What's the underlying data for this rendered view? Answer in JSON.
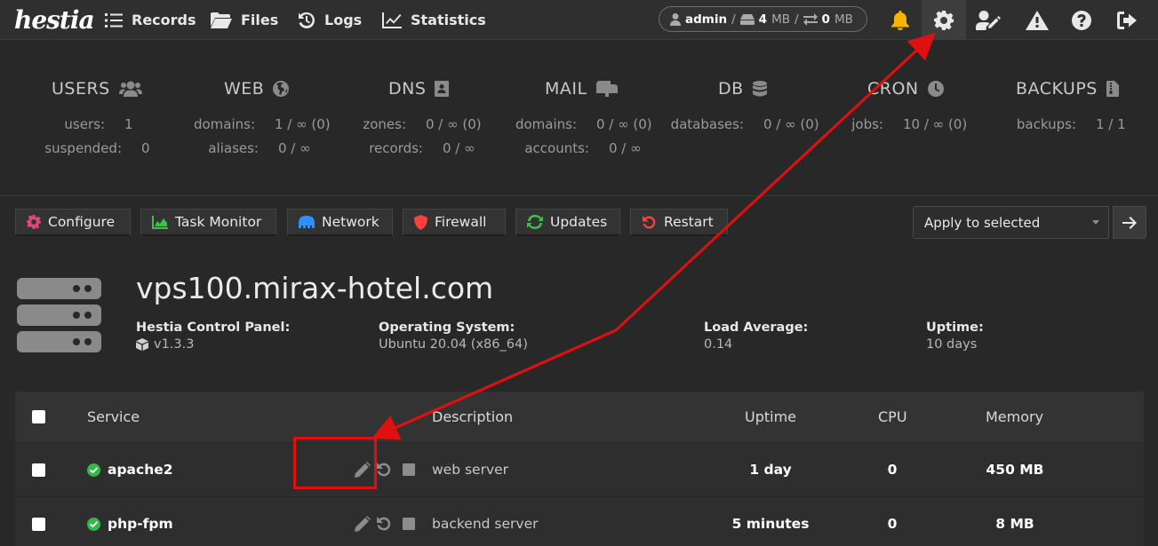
{
  "header": {
    "logo": "hestia",
    "nav": [
      {
        "label": "Records",
        "icon": "list-icon"
      },
      {
        "label": "Files",
        "icon": "folder-icon"
      },
      {
        "label": "Logs",
        "icon": "history-icon"
      },
      {
        "label": "Statistics",
        "icon": "chart-line-icon"
      }
    ],
    "user": {
      "name": "admin",
      "disk": "4",
      "disk_unit": "MB",
      "bandwidth": "0",
      "bandwidth_unit": "MB",
      "sep": "/"
    },
    "icons": [
      "bell-icon",
      "gear-icon",
      "user-edit-icon",
      "warning-icon",
      "help-icon",
      "logout-icon"
    ],
    "colors": {
      "bell": "#f7b500",
      "active_bg": "#3d3d3d"
    }
  },
  "stats": [
    {
      "title": "USERS",
      "icon": "users-icon",
      "rows": [
        {
          "k": "users:",
          "v": "1"
        },
        {
          "k": "suspended:",
          "v": "0"
        }
      ]
    },
    {
      "title": "WEB",
      "icon": "globe-icon",
      "rows": [
        {
          "k": "domains:",
          "v": "1 / ∞ (0)"
        },
        {
          "k": "aliases:",
          "v": "0 / ∞"
        }
      ]
    },
    {
      "title": "DNS",
      "icon": "address-book-icon",
      "rows": [
        {
          "k": "zones:",
          "v": "0 / ∞ (0)"
        },
        {
          "k": "records:",
          "v": "0 / ∞"
        }
      ]
    },
    {
      "title": "MAIL",
      "icon": "mailbox-icon",
      "rows": [
        {
          "k": "domains:",
          "v": "0 / ∞ (0)"
        },
        {
          "k": "accounts:",
          "v": "0 / ∞"
        }
      ]
    },
    {
      "title": "DB",
      "icon": "database-icon",
      "rows": [
        {
          "k": "databases:",
          "v": "0 / ∞ (0)"
        }
      ]
    },
    {
      "title": "CRON",
      "icon": "clock-icon",
      "rows": [
        {
          "k": "jobs:",
          "v": "10 / ∞ (0)"
        }
      ]
    },
    {
      "title": "BACKUPS",
      "icon": "file-archive-icon",
      "rows": [
        {
          "k": "backups:",
          "v": "1 / 1"
        }
      ]
    }
  ],
  "toolbar": {
    "buttons": [
      {
        "label": "Configure",
        "icon": "cog-icon",
        "color": "#e0457b"
      },
      {
        "label": "Task Monitor",
        "icon": "area-chart-icon",
        "color": "#3cc24a"
      },
      {
        "label": "Network",
        "icon": "ethernet-icon",
        "color": "#2e90ff"
      },
      {
        "label": "Firewall",
        "icon": "shield-icon",
        "color": "#ff4040"
      },
      {
        "label": "Updates",
        "icon": "sync-icon",
        "color": "#3cc24a"
      },
      {
        "label": "Restart",
        "icon": "undo-icon",
        "color": "#ff4040"
      }
    ],
    "apply_select": "Apply to selected"
  },
  "server": {
    "hostname": "vps100.mirax-hotel.com",
    "info": [
      {
        "label": "Hestia Control Panel:",
        "value": "v1.3.3",
        "icon": "cube-icon"
      },
      {
        "label": "Operating System:",
        "value": "Ubuntu 20.04 (x86_64)"
      },
      {
        "label": "Load Average:",
        "value": "0.14"
      },
      {
        "label": "Uptime:",
        "value": "10 days"
      }
    ]
  },
  "table": {
    "headers": {
      "service": "Service",
      "description": "Description",
      "uptime": "Uptime",
      "cpu": "CPU",
      "memory": "Memory"
    },
    "rows": [
      {
        "service": "apache2",
        "description": "web server",
        "uptime": "1 day",
        "cpu": "0",
        "memory": "450 MB"
      },
      {
        "service": "php-fpm",
        "description": "backend server",
        "uptime": "5 minutes",
        "cpu": "0",
        "memory": "8 MB"
      }
    ]
  },
  "annotation_color": "#e01010"
}
